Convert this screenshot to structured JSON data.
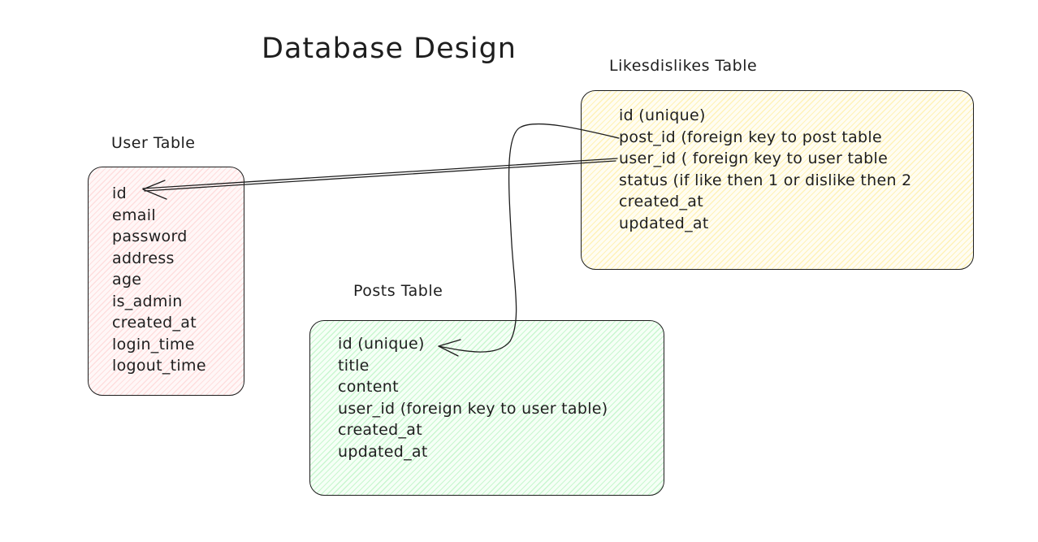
{
  "title": "Database Design",
  "user_table": {
    "label": "User Table",
    "fields": [
      "id",
      "email",
      "password",
      "address",
      "age",
      "is_admin",
      "created_at",
      "login_time",
      "logout_time"
    ]
  },
  "likes_table": {
    "label": "Likesdislikes Table",
    "fields": [
      "id (unique)",
      "post_id (foreign key to post table",
      "user_id ( foreign key to user table",
      "status (if like then 1 or dislike then 2",
      "created_at",
      "updated_at"
    ]
  },
  "posts_table": {
    "label": "Posts Table",
    "fields": [
      "id (unique)",
      "title",
      "content",
      "user_id (foreign key to user table)",
      "created_at",
      "updated_at"
    ]
  },
  "colors": {
    "stroke": "#1e1e1e",
    "user_fill": "#ffc9c9",
    "likes_fill": "#ffec99",
    "posts_fill": "#b2f2bb"
  }
}
